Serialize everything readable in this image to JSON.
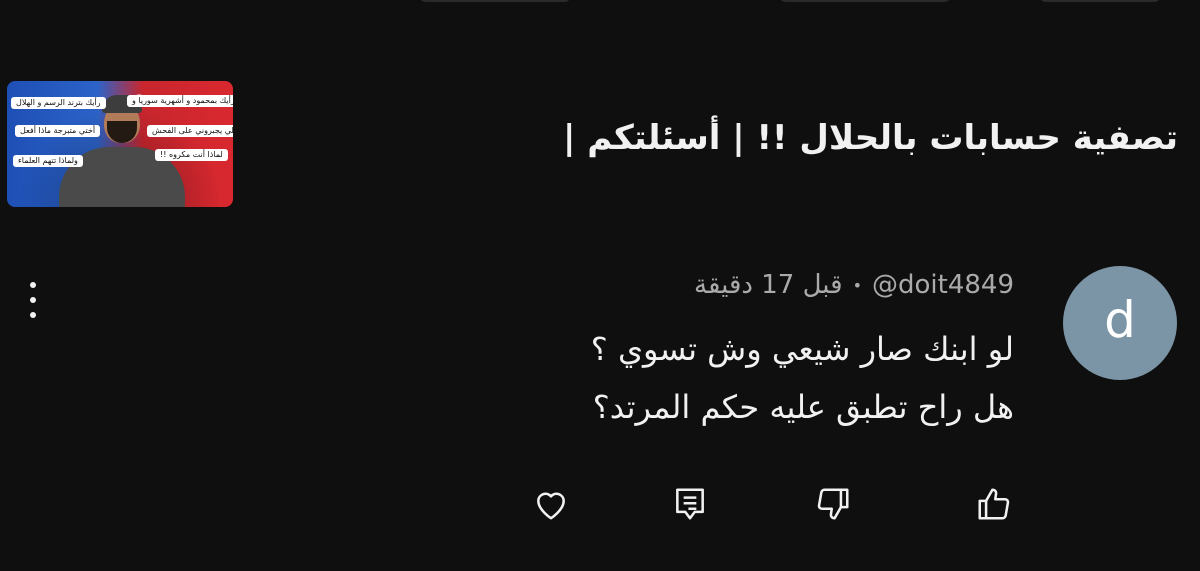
{
  "video": {
    "title": "تصفية حسابات بالحلال !! | أسئلتكم |",
    "thumbnail_labels": [
      "رأيك بترند الرسم و الهلال",
      "رأيك بمحمود و أشهرية سوريا و",
      "أختي متبرجة ماذا أفعل",
      "أهلي يجبروني على الفحش",
      "ولماذا تتهم العلماء",
      "لماذا أنت مكروه !!"
    ]
  },
  "comment": {
    "avatar_letter": "d",
    "handle": "@doit4849",
    "separator": "•",
    "time": "قبل 17 دقيقة",
    "lines": [
      "لو ابنك صار شيعي وش تسوي ؟",
      "هل راح تطبق عليه حكم المرتد؟"
    ]
  },
  "actions": {
    "like_icon": "thumbs-up-icon",
    "dislike_icon": "thumbs-down-icon",
    "reply_icon": "reply-comment-icon",
    "heart_icon": "heart-icon",
    "more_icon": "more-vertical-icon"
  },
  "colors": {
    "background": "#0f0f0f",
    "avatar": "#7c95a6",
    "meta_text": "#aaaaaa",
    "primary_text": "#f1f1f1"
  }
}
